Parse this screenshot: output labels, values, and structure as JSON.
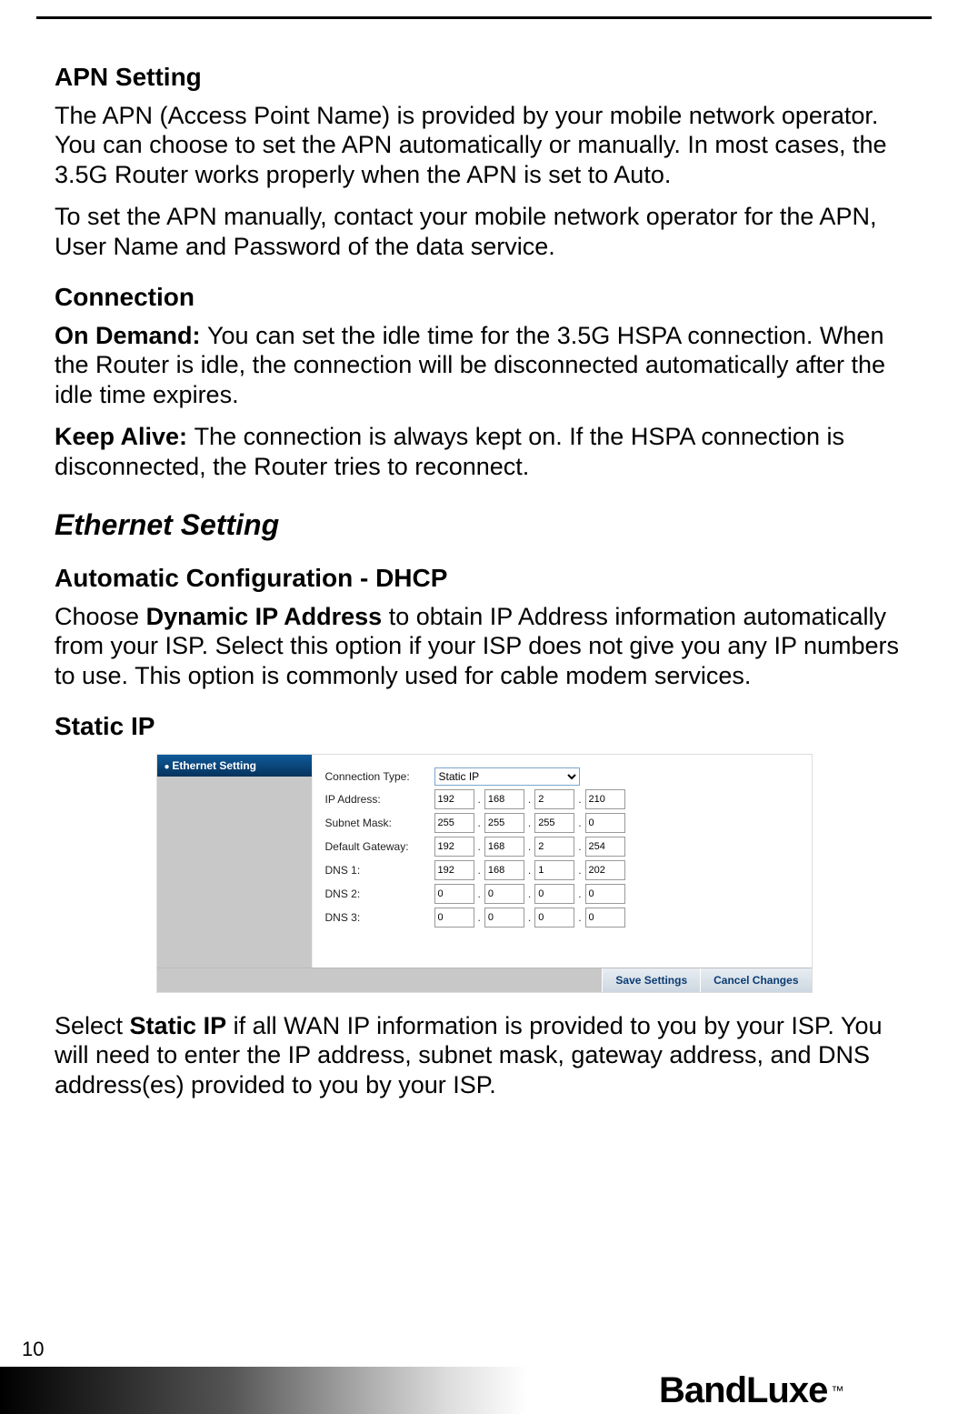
{
  "apn": {
    "heading": "APN Setting",
    "p1": "The APN (Access Point Name) is provided by your mobile network operator. You can choose to set the APN automatically or manually. In most cases, the 3.5G Router works properly when the APN is set to Auto.",
    "p2": "To set the APN manually, contact your mobile network operator for the APN, User Name and Password of the data service."
  },
  "connection": {
    "heading": "Connection",
    "ondemand_label": "On Demand: ",
    "ondemand_text": "You can set the idle time for the 3.5G HSPA connection. When the Router is idle, the connection will be disconnected automatically after the idle time expires.",
    "keepalive_label": "Keep Alive: ",
    "keepalive_text": "The connection is always kept on. If the HSPA connection is disconnected, the Router tries to reconnect."
  },
  "ethernet": {
    "heading": "Ethernet Setting"
  },
  "dhcp": {
    "heading": "Automatic Configuration - DHCP",
    "p1a": "Choose ",
    "bold": "Dynamic IP Address",
    "p1b": " to obtain IP Address information automatically from your ISP. Select this option if your ISP does not give you any IP numbers to use. This option is commonly used for cable modem services."
  },
  "staticip": {
    "heading": "Static IP",
    "p1a": "Select ",
    "bold": "Static IP",
    "p1b": " if all WAN IP information is provided to you by your ISP. You will need to enter the IP address, subnet mask, gateway address, and DNS address(es) provided to you by your ISP."
  },
  "ui": {
    "sidebar_title": "Ethernet Setting",
    "labels": {
      "conn_type": "Connection Type:",
      "ip": "IP Address:",
      "mask": "Subnet Mask:",
      "gw": "Default Gateway:",
      "dns1": "DNS 1:",
      "dns2": "DNS 2:",
      "dns3": "DNS 3:"
    },
    "conn_type_value": "Static IP",
    "ip": [
      "192",
      "168",
      "2",
      "210"
    ],
    "mask": [
      "255",
      "255",
      "255",
      "0"
    ],
    "gw": [
      "192",
      "168",
      "2",
      "254"
    ],
    "dns1": [
      "192",
      "168",
      "1",
      "202"
    ],
    "dns2": [
      "0",
      "0",
      "0",
      "0"
    ],
    "dns3": [
      "0",
      "0",
      "0",
      "0"
    ],
    "save_btn": "Save Settings",
    "cancel_btn": "Cancel Changes"
  },
  "footer": {
    "page": "10",
    "brand": "BandLuxe",
    "tm": "™"
  }
}
